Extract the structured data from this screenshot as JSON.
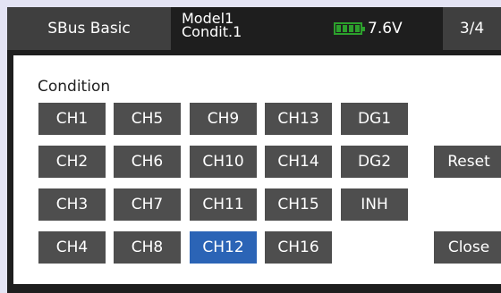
{
  "header": {
    "title": "SBus Basic",
    "model_name": "Model1",
    "condition": "Condit.1",
    "battery_voltage": "7.6V",
    "page": "3/4"
  },
  "panel": {
    "section_label": "Condition",
    "grid": [
      [
        "CH1",
        "CH5",
        "CH9",
        "CH13",
        "DG1"
      ],
      [
        "CH2",
        "CH6",
        "CH10",
        "CH14",
        "DG2"
      ],
      [
        "CH3",
        "CH7",
        "CH11",
        "CH15",
        "INH"
      ],
      [
        "CH4",
        "CH8",
        "CH12",
        "CH16"
      ]
    ],
    "selected": "CH12",
    "reset_label": "Reset",
    "close_label": "Close"
  },
  "colors": {
    "button": "#4e4e4e",
    "selected": "#2b64b6",
    "battery": "#2ca02c"
  },
  "icons": [
    "battery-icon"
  ]
}
